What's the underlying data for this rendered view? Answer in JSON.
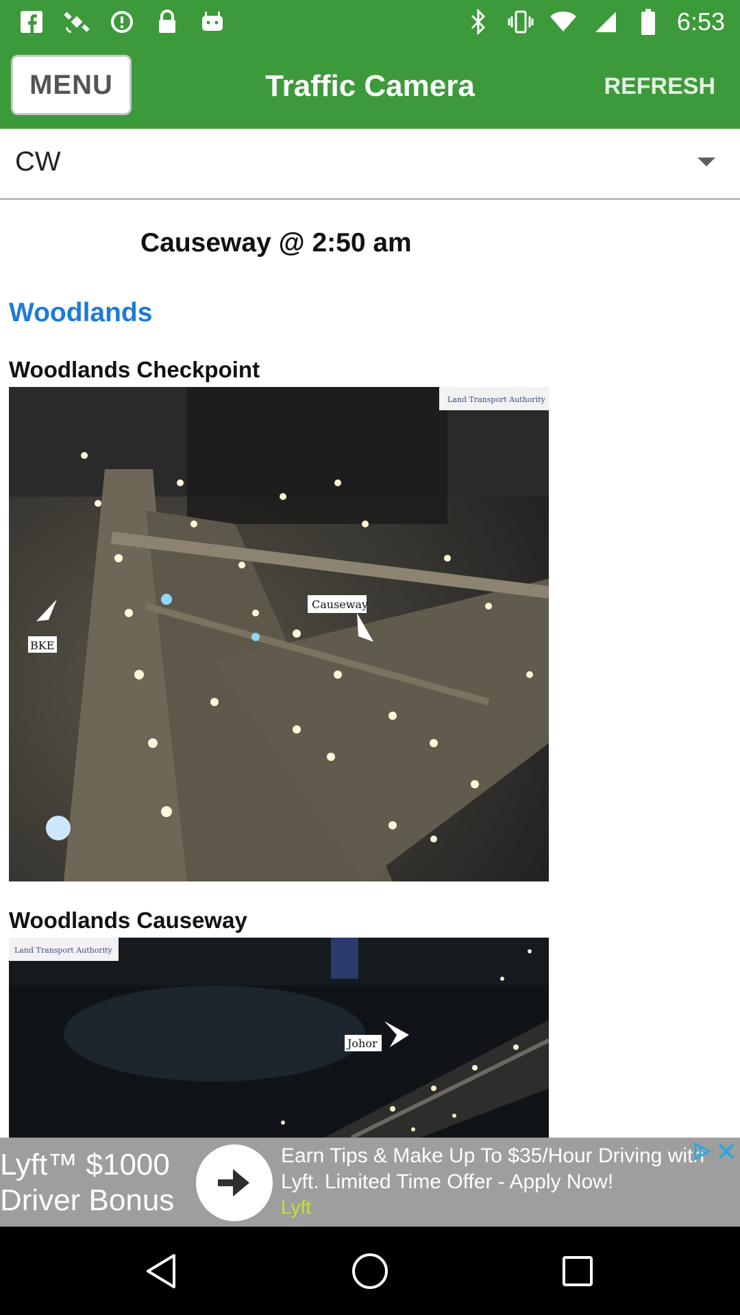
{
  "status_bar": {
    "time": "6:53",
    "left_icons": [
      "facebook-icon",
      "satellite-icon",
      "data-saver-icon",
      "lock-icon",
      "android-icon"
    ],
    "right_icons": [
      "bluetooth-icon",
      "vibrate-icon",
      "wifi-icon",
      "signal-icon",
      "battery-icon"
    ]
  },
  "app_bar": {
    "menu_label": "MENU",
    "title": "Traffic Camera",
    "refresh_label": "REFRESH",
    "background_color": "#3d9a3b"
  },
  "dropdown": {
    "selected_value": "CW",
    "icon": "caret-down-icon"
  },
  "content": {
    "heading": "Causeway @ 2:50 am",
    "section_title": "Woodlands",
    "section_color": "#1e7bd6",
    "cameras": [
      {
        "label": "Woodlands Checkpoint",
        "watermark": "Land Transport Authority",
        "sign_labels": [
          "Causeway",
          "BKE"
        ]
      },
      {
        "label": "Woodlands Causeway",
        "watermark": "Land Transport Authority",
        "sign_labels": [
          "Johor"
        ]
      }
    ]
  },
  "ad": {
    "headline": "Lyft™ $1000 Driver Bonus",
    "headline_line1": "Lyft™ $1000",
    "headline_line2": "Driver Bonus",
    "body": "Earn Tips & Make Up To $35/Hour Driving with Lyft. Limited Time Offer - Apply Now!",
    "advertiser": "Lyft"
  },
  "nav_bar": {
    "buttons": [
      "back-icon",
      "home-icon",
      "recents-icon"
    ]
  }
}
